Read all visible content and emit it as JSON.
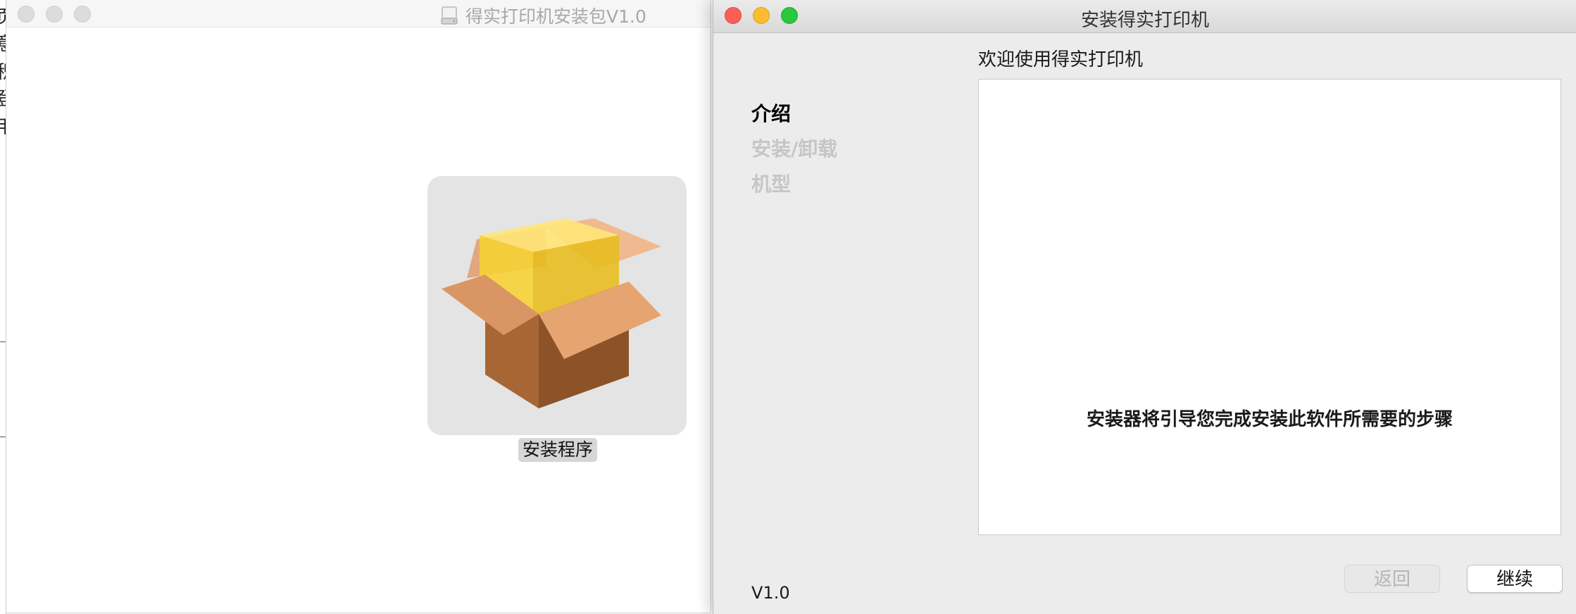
{
  "background_window": {
    "edge_chars": [
      "页",
      "意",
      "积",
      "登",
      "用"
    ]
  },
  "dmg_window": {
    "title": "得实打印机安装包V1.0",
    "title_icon": "disk-icon",
    "package": {
      "icon": "package-icon",
      "label": "安装程序"
    }
  },
  "installer": {
    "title": "安装得实打印机",
    "heading": "欢迎使用得实打印机",
    "steps": [
      {
        "label": "介绍",
        "active": true
      },
      {
        "label": "安装/卸载",
        "active": false
      },
      {
        "label": "机型",
        "active": false
      }
    ],
    "message": "安装器将引导您完成安装此软件所需要的步骤",
    "version": "V1.0",
    "back_label": "返回",
    "continue_label": "继续",
    "colors": {
      "close": "#fc5f57",
      "minimize": "#fdbc2e",
      "zoom": "#28c840"
    }
  }
}
